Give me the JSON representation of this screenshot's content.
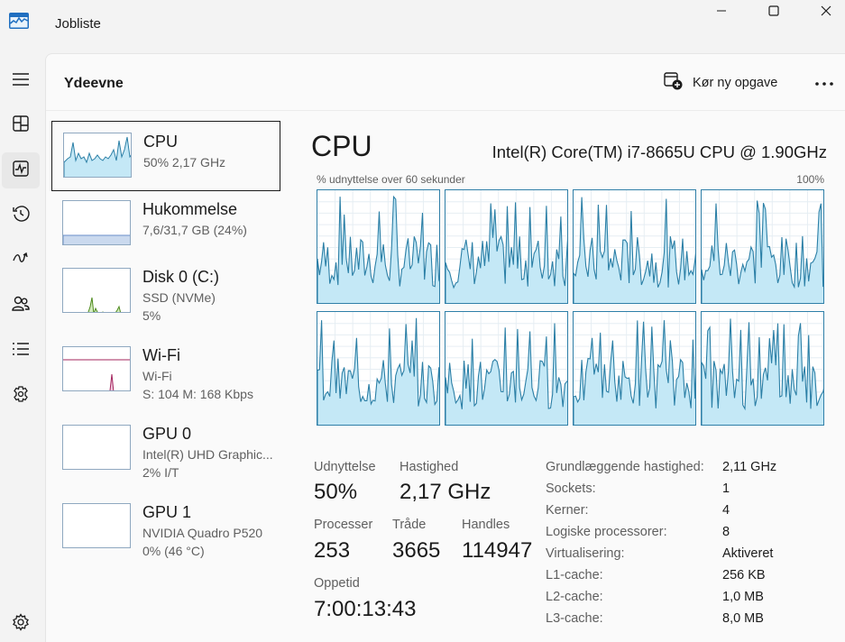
{
  "window": {
    "title": "Jobliste"
  },
  "nav": {
    "items": [
      {
        "icon": "hamburger-icon"
      },
      {
        "icon": "processes-icon"
      },
      {
        "icon": "performance-icon",
        "active": true
      },
      {
        "icon": "app-history-icon"
      },
      {
        "icon": "startup-apps-icon"
      },
      {
        "icon": "users-icon"
      },
      {
        "icon": "details-icon"
      },
      {
        "icon": "services-icon"
      },
      {
        "icon": "settings-icon"
      }
    ]
  },
  "header": {
    "title": "Ydeevne",
    "run_task_label": "Kør ny opgave"
  },
  "devices": [
    {
      "name": "CPU",
      "line1": "50%  2,17 GHz",
      "line2": ""
    },
    {
      "name": "Hukommelse",
      "line1": "7,6/31,7 GB (24%)",
      "line2": ""
    },
    {
      "name": "Disk 0 (C:)",
      "line1": "SSD (NVMe)",
      "line2": "5%"
    },
    {
      "name": "Wi-Fi",
      "line1": "Wi-Fi",
      "line2": "S: 104  M: 168 Kbps"
    },
    {
      "name": "GPU 0",
      "line1": "Intel(R) UHD Graphic...",
      "line2": "2% I/T"
    },
    {
      "name": "GPU 1",
      "line1": "NVIDIA Quadro P520",
      "line2": "0% (46 °C)"
    }
  ],
  "cpu": {
    "title": "CPU",
    "model": "Intel(R) Core(TM) i7-8665U CPU @ 1.90GHz",
    "graph_caption": "% udnyttelse over 60 sekunder",
    "graph_max": "100%",
    "stats": {
      "utilization_label": "Udnyttelse",
      "utilization": "50%",
      "speed_label": "Hastighed",
      "speed": "2,17 GHz",
      "processes_label": "Processer",
      "processes": "253",
      "threads_label": "Tråde",
      "threads": "3665",
      "handles_label": "Handles",
      "handles": "114947",
      "uptime_label": "Oppetid",
      "uptime": "7:00:13:43"
    },
    "details": [
      {
        "label": "Grundlæggende hastighed:",
        "value": "2,11 GHz"
      },
      {
        "label": "Sockets:",
        "value": "1"
      },
      {
        "label": "Kerner:",
        "value": "4"
      },
      {
        "label": "Logiske processorer:",
        "value": "8"
      },
      {
        "label": "Virtualisering:",
        "value": "Aktiveret"
      },
      {
        "label": "L1-cache:",
        "value": "256 KB"
      },
      {
        "label": "L2-cache:",
        "value": "1,0 MB"
      },
      {
        "label": "L3-cache:",
        "value": "8,0 MB"
      }
    ]
  },
  "colors": {
    "cpu_line": "#2b7fa6",
    "cpu_fill": "#c4e8f6",
    "memory_line": "#6a8ec9",
    "disk_line": "#4d8a1c",
    "wifi_line": "#a3245e",
    "gpu_line": "#8a3fc4"
  }
}
